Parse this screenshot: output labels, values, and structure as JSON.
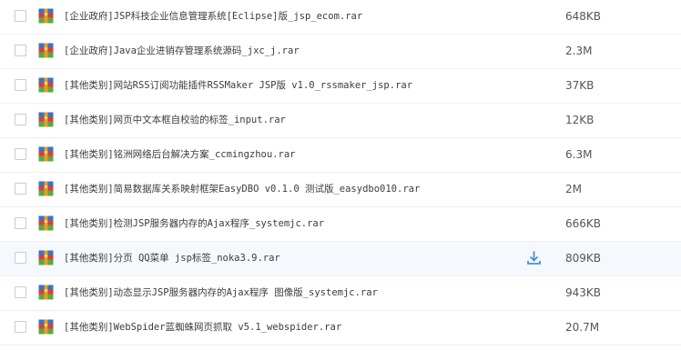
{
  "icons": {
    "file": "rar-archive-icon",
    "action": "download-icon"
  },
  "colors": {
    "hover_row": "#f5f8fd",
    "download_icon": "#4a8fd6",
    "divider": "#eef0f4"
  },
  "files": [
    {
      "name": "[企业政府]JSP科技企业信息管理系统[Eclipse]版_jsp_ecom.rar",
      "size": "648KB"
    },
    {
      "name": "[企业政府]Java企业进销存管理系统源码_jxc_j.rar",
      "size": "2.3M"
    },
    {
      "name": "[其他类别]网站RSS订阅功能插件RSSMaker JSP版 v1.0_rssmaker_jsp.rar",
      "size": "37KB"
    },
    {
      "name": "[其他类别]网页中文本框自校验的标签_input.rar",
      "size": "12KB"
    },
    {
      "name": "[其他类别]铭洲网络后台解决方案_ccmingzhou.rar",
      "size": "6.3M"
    },
    {
      "name": "[其他类别]简易数据库关系映射框架EasyDBO v0.1.0 测试版_easydbo010.rar",
      "size": "2M"
    },
    {
      "name": "[其他类别]检测JSP服务器内存的Ajax程序_systemjc.rar",
      "size": "666KB"
    },
    {
      "name": "[其他类别]分页 QQ菜单 jsp标签_noka3.9.rar",
      "size": "809KB"
    },
    {
      "name": "[其他类别]动态显示JSP服务器内存的Ajax程序 图像版_systemjc.rar",
      "size": "943KB"
    },
    {
      "name": "[其他类别]WebSpider蓝蜘蛛网页抓取 v5.1_webspider.rar",
      "size": "20.7M"
    }
  ]
}
